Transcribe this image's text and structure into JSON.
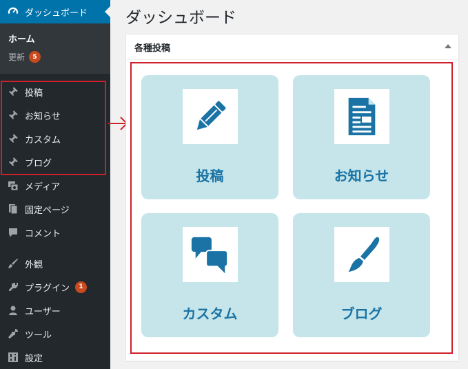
{
  "sidebar": {
    "dashboard_label": "ダッシュボード",
    "home_label": "ホーム",
    "update_label": "更新",
    "update_count": "5",
    "items": [
      {
        "label": "投稿",
        "icon": "pin-icon"
      },
      {
        "label": "お知らせ",
        "icon": "pin-icon"
      },
      {
        "label": "カスタム",
        "icon": "pin-icon"
      },
      {
        "label": "ブログ",
        "icon": "pin-icon"
      },
      {
        "label": "メディア",
        "icon": "media-icon"
      },
      {
        "label": "固定ページ",
        "icon": "page-icon"
      },
      {
        "label": "コメント",
        "icon": "comment-icon"
      },
      {
        "label": "外観",
        "icon": "appearance-icon"
      },
      {
        "label": "プラグイン",
        "icon": "plugin-icon",
        "badge": "1"
      },
      {
        "label": "ユーザー",
        "icon": "user-icon"
      },
      {
        "label": "ツール",
        "icon": "tool-icon"
      },
      {
        "label": "設定",
        "icon": "settings-icon"
      }
    ]
  },
  "main": {
    "title": "ダッシュボード",
    "panel_title": "各種投稿",
    "tiles": [
      {
        "label": "投稿",
        "icon": "pencil-icon"
      },
      {
        "label": "お知らせ",
        "icon": "document-icon"
      },
      {
        "label": "カスタム",
        "icon": "speech-bubbles-icon"
      },
      {
        "label": "ブログ",
        "icon": "paintbrush-icon"
      }
    ]
  },
  "colors": {
    "sidebar_bg": "#23282d",
    "active_blue": "#0073aa",
    "highlight_red": "#d0202c",
    "tile_bg": "#c5e5ea",
    "tile_text": "#1a73a4",
    "badge": "#ca4a1f"
  }
}
